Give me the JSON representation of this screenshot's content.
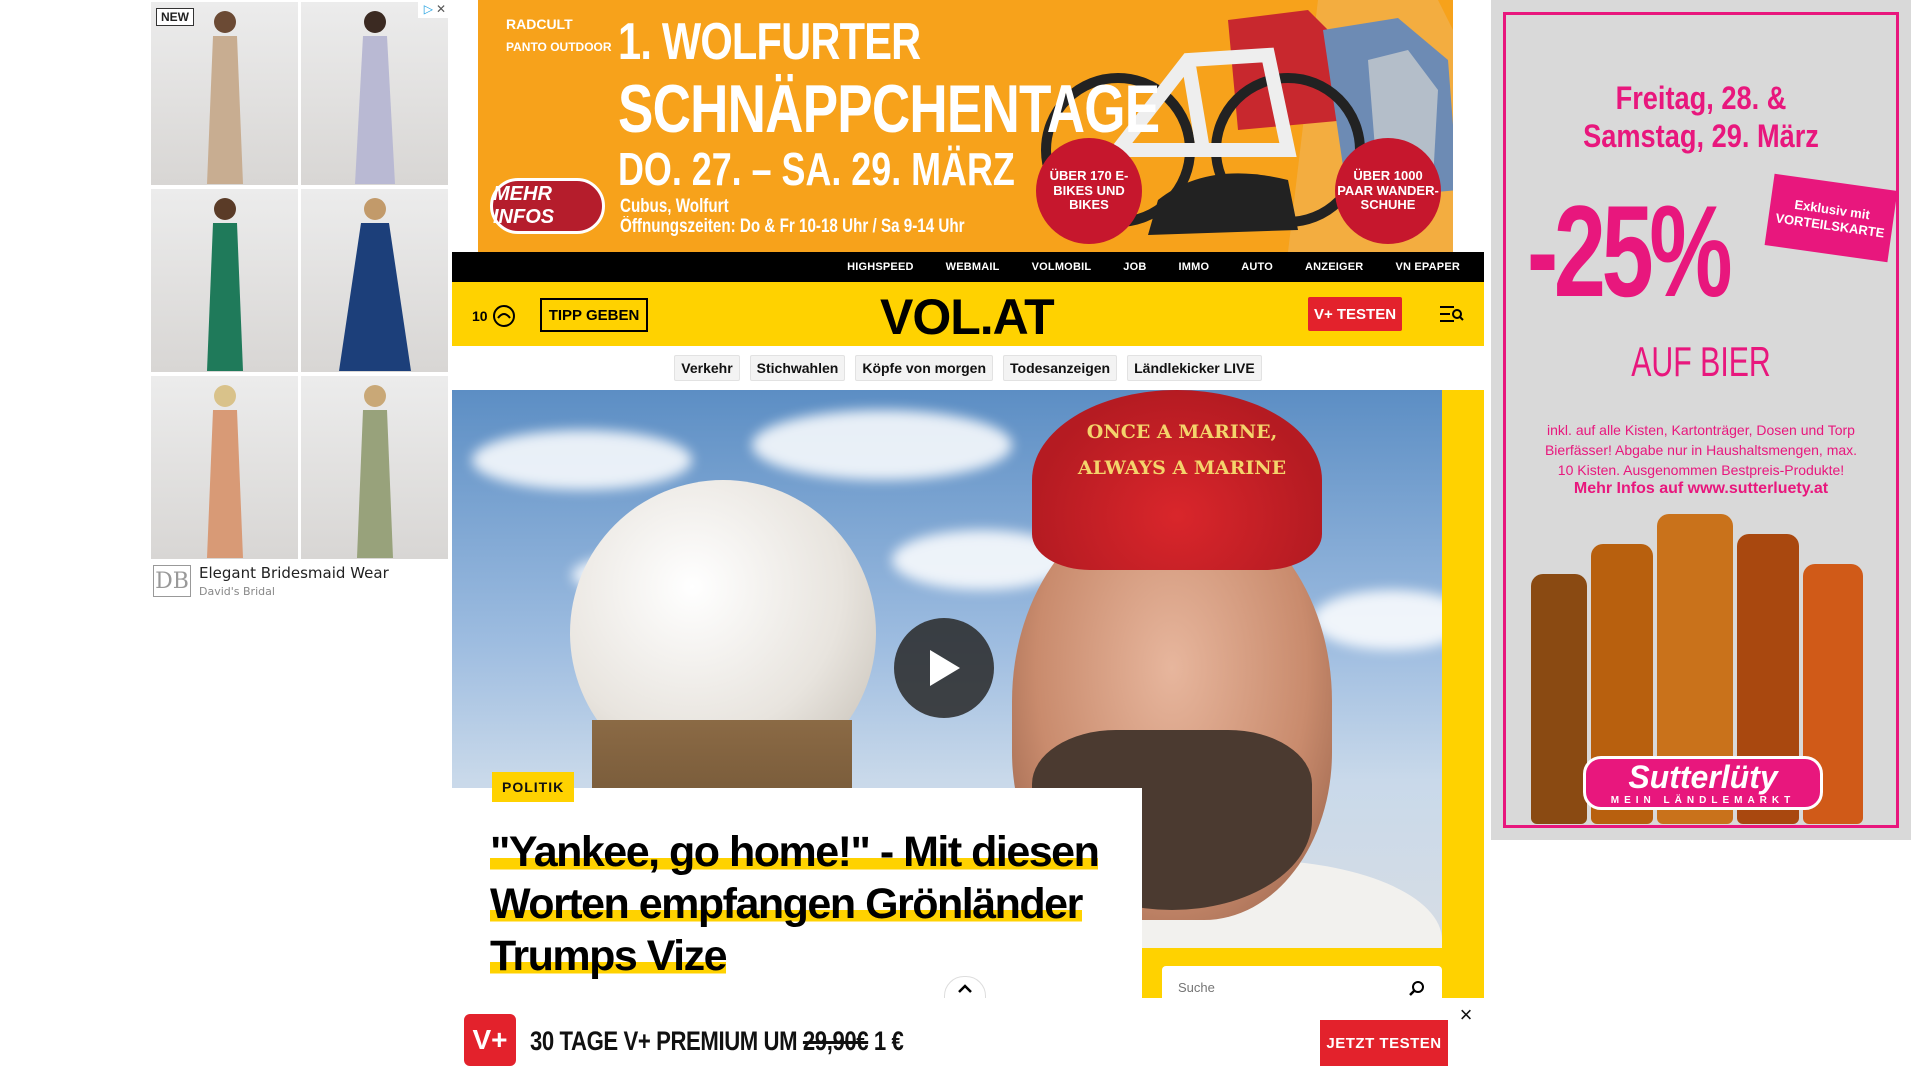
{
  "left_ad": {
    "new_badge": "NEW",
    "title": "Elegant Bridesmaid Wear",
    "sponsor": "David's Bridal",
    "logo": "DB",
    "dress_colors": [
      "#c8ad91",
      "#b9b9d3",
      "#1f7a5a",
      "#1c3f7a",
      "#d89a76",
      "#98a27b"
    ]
  },
  "top_banner": {
    "brand1": "RADCULT",
    "brand2": "PANTO OUTDOOR",
    "headline1": "1. WOLFURTER",
    "headline2": "SCHNÄPPCHENTAGE",
    "dates": "DO. 27. – SA. 29. MÄRZ",
    "location": "Cubus, Wolfurt",
    "hours": "Öffnungszeiten: Do & Fr 10-18 Uhr / Sa 9-14 Uhr",
    "more_button": "MEHR INFOS",
    "badge1": "ÜBER 170 E-BIKES UND BIKES",
    "badge2": "ÜBER 1000 PAAR WANDER-SCHUHE"
  },
  "topnav": [
    "HIGHSPEED",
    "WEBMAIL",
    "VOLMOBIL",
    "JOB",
    "IMMO",
    "AUTO",
    "ANZEIGER",
    "VN EPAPER"
  ],
  "header": {
    "temperature": "10",
    "tipp_button": "TIPP GEBEN",
    "logo": "VOL.AT",
    "vplus_button": "V+ TESTEN"
  },
  "chips": [
    "Verkehr",
    "Stichwahlen",
    "Köpfe von morgen",
    "Todesanzeigen",
    "Ländlekicker LIVE"
  ],
  "hero": {
    "cap_line1": "ONCE A MARINE,",
    "cap_line2": "ALWAYS A MARINE",
    "tag": "POLITIK",
    "headline": "\"Yankee, go home!\" - Mit diesen Worten empfangen Grönländer Trumps Vize"
  },
  "search": {
    "placeholder": "Suche"
  },
  "right_ad": {
    "date1": "Freitag, 28. &",
    "date2": "Samstag, 29. März",
    "percent": "-25%",
    "exclusive": "Exklusiv mit VORTEILSKARTE",
    "product": "AUF BIER",
    "small_print": "inkl. auf alle Kisten, Kartonträger, Dosen und Torp Bierfässer! Abgabe nur in Haushaltsmengen, max. 10 Kisten. Ausgenommen Bestpreis-Produkte!",
    "more_info": "Mehr Infos auf www.sutterluety.at",
    "logo_main": "Sutterlüty",
    "logo_sub": "MEIN LÄNDLEMARKT",
    "bottle_colors": [
      "#8a4a12",
      "#b8600e",
      "#c9721b",
      "#a9480f",
      "#d05a18"
    ]
  },
  "sticky_bar": {
    "logo": "V+",
    "text_prefix": "30 TAGE V+ PREMIUM UM ",
    "old_price": "29,90€",
    "new_price": " 1 €",
    "button": "JETZT TESTEN",
    "close": "×"
  }
}
